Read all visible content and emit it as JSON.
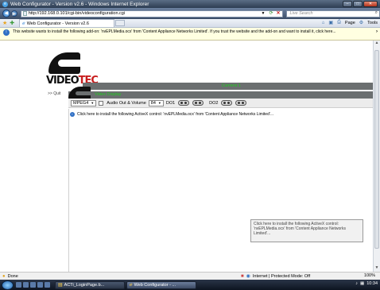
{
  "window": {
    "title": "Web Configurator - Version v2.6 - Windows Internet Explorer",
    "controls": {
      "minimize": "–",
      "maximize": "□",
      "close": "✕"
    }
  },
  "address_bar": {
    "url": "http://192.168.0.101/cgi-bin/videoconfiguration.cgi",
    "search_placeholder": "Live Search"
  },
  "tabs": [
    {
      "label": "Web Configurator - Version v2.6"
    }
  ],
  "command_bar": {
    "page_label": "Page",
    "tools_label": "Tools"
  },
  "info_bar": {
    "message": "This website wants to install the following add-on: 'nvEPLMedia.ocx' from 'Content Appliance Networks Limited'. If you trust the website and the add-on and want to install it, click here..."
  },
  "page": {
    "logo_text_black": "VIDEO",
    "logo_text_red": "TEC",
    "camera_header": "Camera 1",
    "quit_label": ">> Quit",
    "section_header": "Video Display",
    "controls": {
      "codec_value": "MPEG4",
      "audio_label": "Audio Out & Volume",
      "volume_value": "84",
      "do1_label": "DO1",
      "do2_label": "DO2"
    },
    "activex_prompt": "Click here to install the following ActiveX control: 'nvEPLMedia.ocx' from 'Content Appliance Networks Limited'...",
    "tooltip_text": "Click here to install the following ActiveX control: 'nvEPLMedia.ocx' from 'Content Appliance Networks Limited'..."
  },
  "status_bar": {
    "status": "Done",
    "zone": "Internet | Protected Mode: Off",
    "zoom": "100%"
  },
  "taskbar": {
    "tasks": [
      {
        "label": "ACTi_LoginPage.b..."
      },
      {
        "label": "Web Configurator - ..."
      }
    ],
    "clock": "10:34"
  }
}
